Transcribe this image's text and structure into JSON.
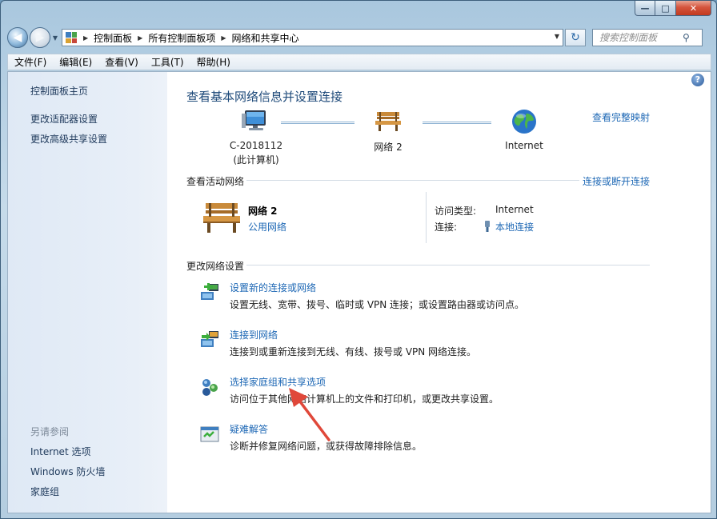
{
  "window": {
    "minimize_glyph": "—",
    "maximize_glyph": "□",
    "close_glyph": "✕"
  },
  "nav": {
    "back_glyph": "◀",
    "forward_glyph": "▶",
    "breadcrumb": [
      "控制面板",
      "所有控制面板项",
      "网络和共享中心"
    ],
    "search_placeholder": "搜索控制面板"
  },
  "menu": [
    "文件(F)",
    "编辑(E)",
    "查看(V)",
    "工具(T)",
    "帮助(H)"
  ],
  "sidebar": {
    "top_links": [
      "控制面板主页",
      "更改适配器设置",
      "更改高级共享设置"
    ],
    "see_also_label": "另请参阅",
    "see_also_links": [
      "Internet 选项",
      "Windows 防火墙",
      "家庭组"
    ]
  },
  "main": {
    "title": "查看基本网络信息并设置连接",
    "full_map_link": "查看完整映射",
    "map": {
      "computer_name": "C-2018112",
      "computer_sub": "(此计算机)",
      "network": "网络  2",
      "internet": "Internet"
    },
    "active": {
      "label": "查看活动网络",
      "connect_link": "连接或断开连接",
      "network_name": "网络  2",
      "network_type": "公用网络",
      "access_key": "访问类型:",
      "access_value": "Internet",
      "conn_key": "连接:",
      "conn_value": "本地连接"
    },
    "change": {
      "label": "更改网络设置",
      "tasks": [
        {
          "link": "设置新的连接或网络",
          "desc": "设置无线、宽带、拨号、临时或 VPN 连接；或设置路由器或访问点。"
        },
        {
          "link": "连接到网络",
          "desc": "连接到或重新连接到无线、有线、拨号或 VPN 网络连接。"
        },
        {
          "link": "选择家庭组和共享选项",
          "desc": "访问位于其他网络计算机上的文件和打印机，或更改共享设置。"
        },
        {
          "link": "疑难解答",
          "desc": "诊断并修复网络问题，或获得故障排除信息。"
        }
      ]
    }
  },
  "colors": {
    "link": "#1e68b5",
    "title": "#1e4a7a",
    "annotation_arrow": "#e0483a"
  }
}
